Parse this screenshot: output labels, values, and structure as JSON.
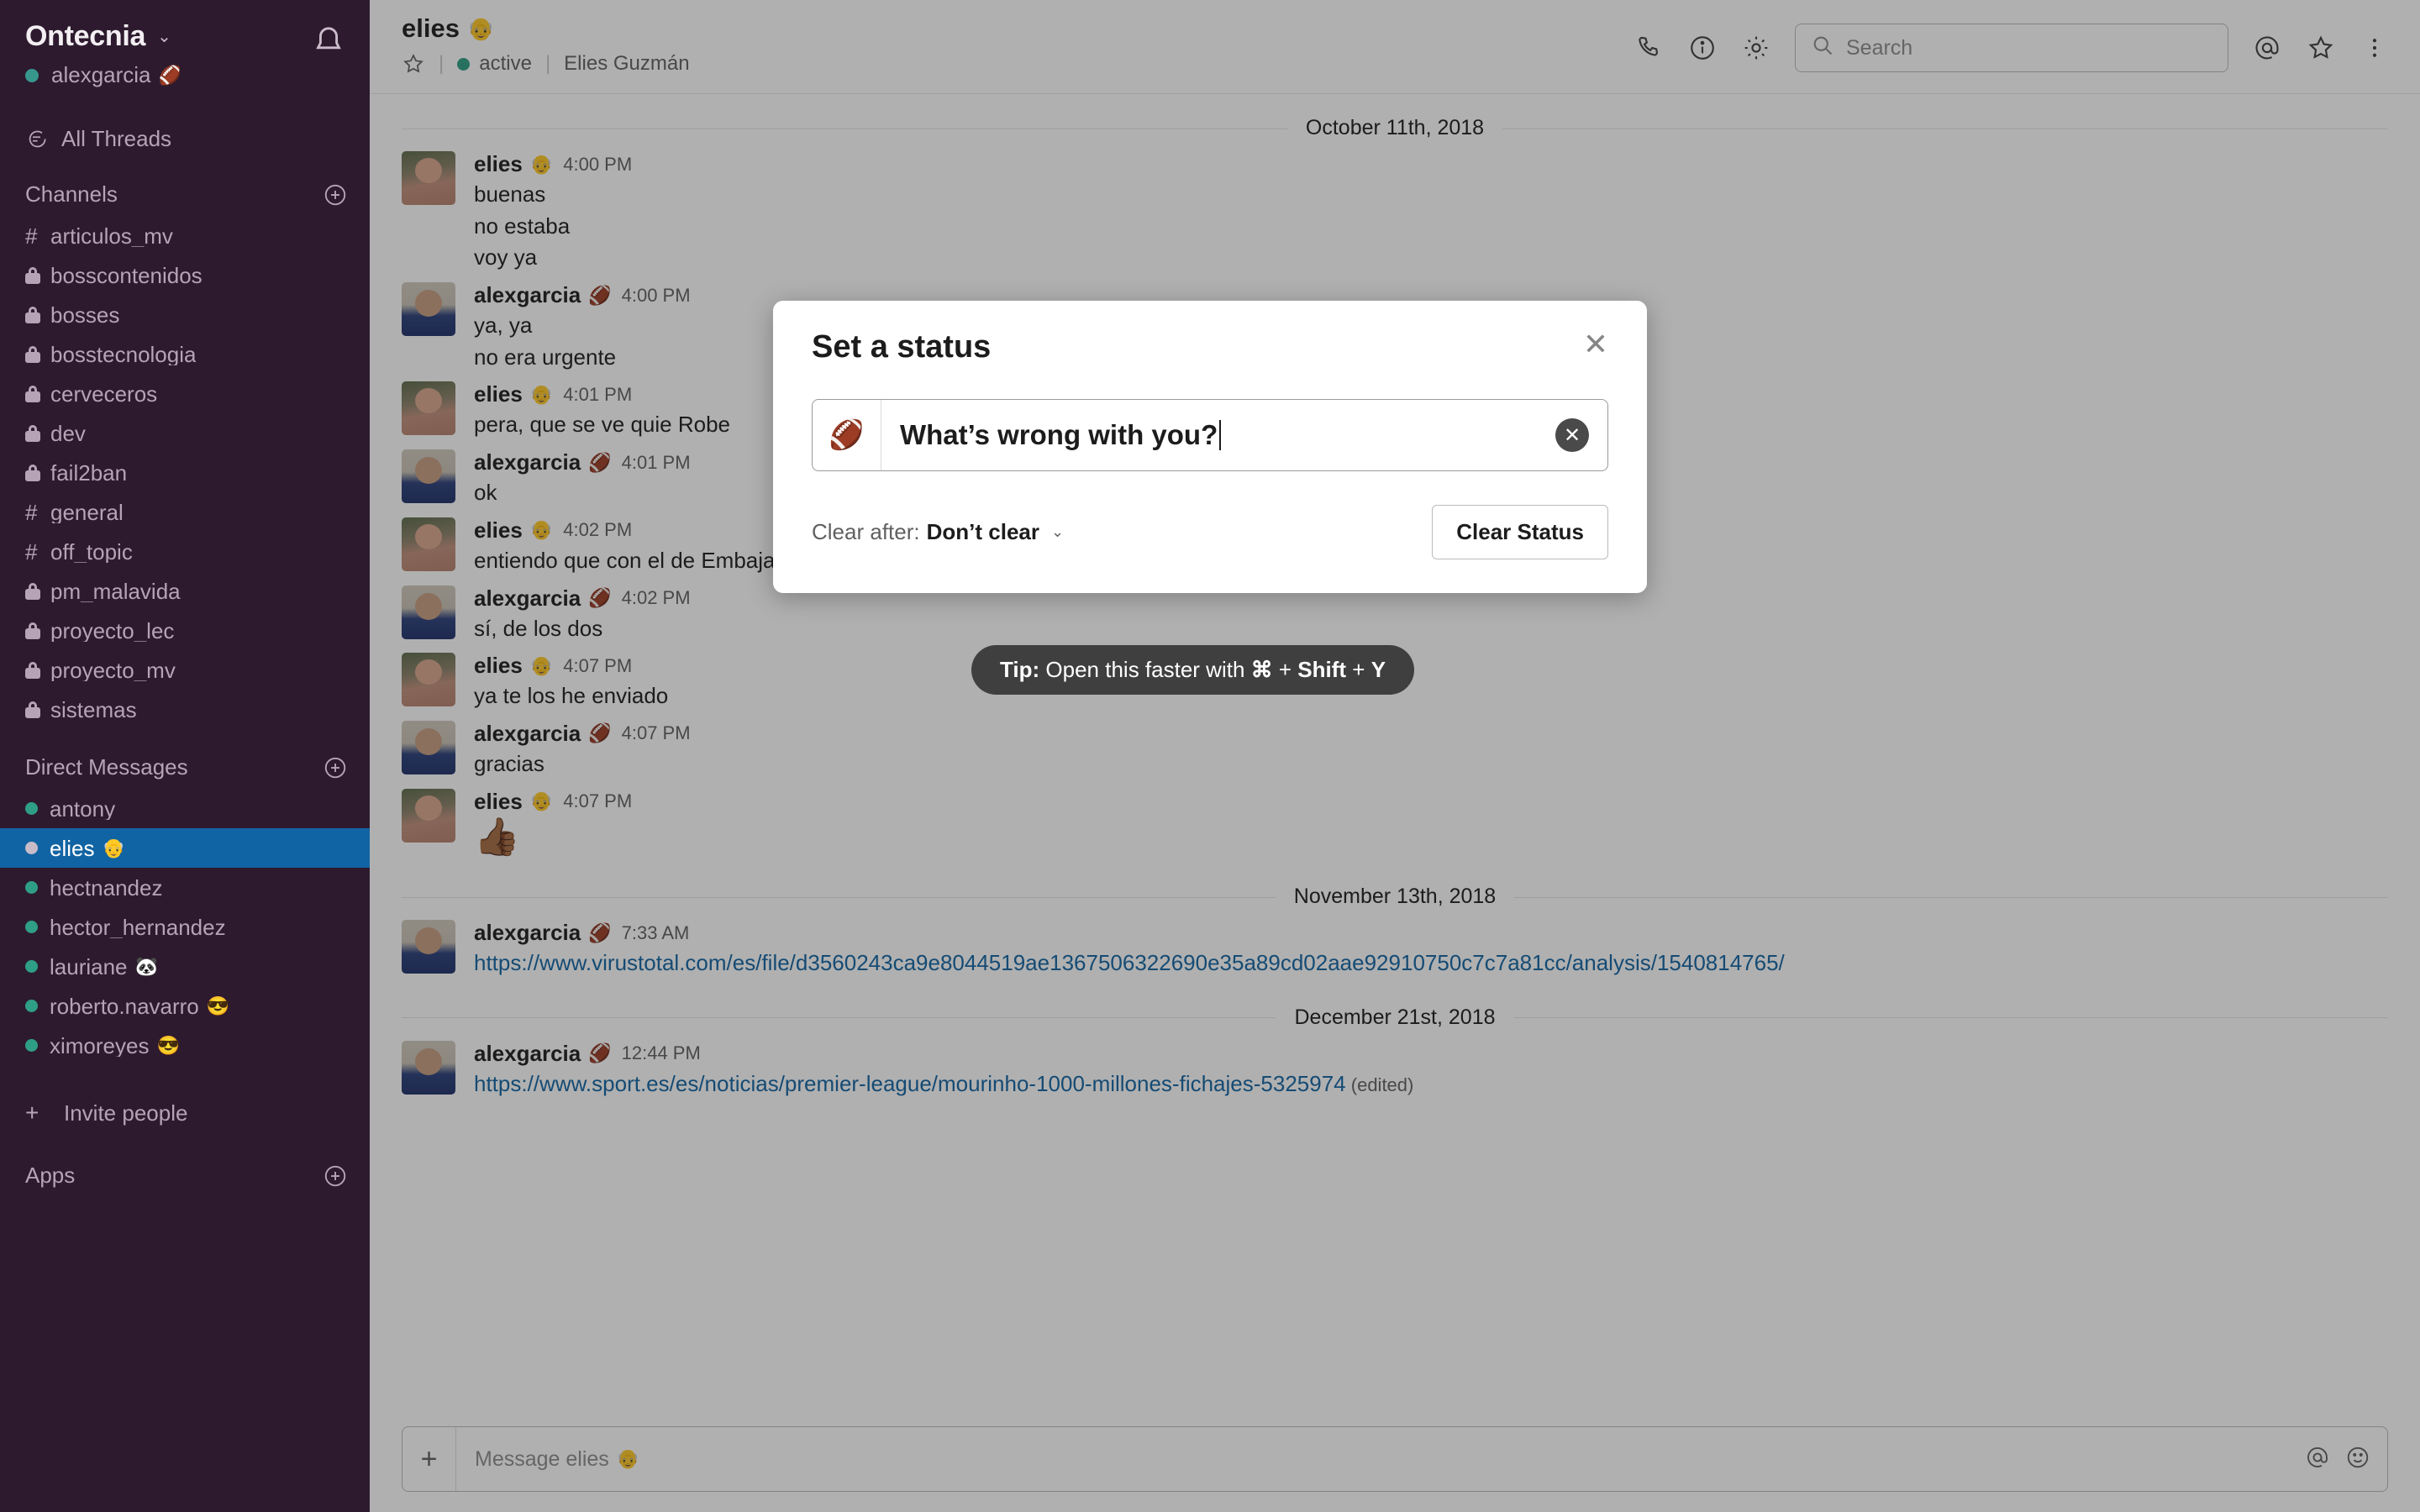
{
  "sidebar": {
    "workspace": "Ontecnia",
    "workspace_caret": "⌄",
    "user": "alexgarcia",
    "user_emoji": "🏈",
    "all_threads": "All Threads",
    "channels_header": "Channels",
    "channels": [
      {
        "name": "articulos_mv",
        "type": "public"
      },
      {
        "name": "bosscontenidos",
        "type": "private"
      },
      {
        "name": "bosses",
        "type": "private"
      },
      {
        "name": "bosstecnologia",
        "type": "private"
      },
      {
        "name": "cerveceros",
        "type": "private"
      },
      {
        "name": "dev",
        "type": "private"
      },
      {
        "name": "fail2ban",
        "type": "private"
      },
      {
        "name": "general",
        "type": "public"
      },
      {
        "name": "off_topic",
        "type": "public"
      },
      {
        "name": "pm_malavida",
        "type": "private"
      },
      {
        "name": "proyecto_lec",
        "type": "private"
      },
      {
        "name": "proyecto_mv",
        "type": "private"
      },
      {
        "name": "sistemas",
        "type": "private"
      }
    ],
    "dms_header": "Direct Messages",
    "dms": [
      {
        "name": "antony",
        "emoji": "",
        "selected": false,
        "presence": "active"
      },
      {
        "name": "elies",
        "emoji": "👴",
        "selected": true,
        "presence": "away"
      },
      {
        "name": "hectnandez",
        "emoji": "",
        "selected": false,
        "presence": "active"
      },
      {
        "name": "hector_hernandez",
        "emoji": "",
        "selected": false,
        "presence": "active"
      },
      {
        "name": "lauriane",
        "emoji": "🐼",
        "selected": false,
        "presence": "active"
      },
      {
        "name": "roberto.navarro",
        "emoji": "😎",
        "selected": false,
        "presence": "active"
      },
      {
        "name": "ximoreyes",
        "emoji": "😎",
        "selected": false,
        "presence": "active"
      }
    ],
    "invite_people": "Invite people",
    "apps_header": "Apps"
  },
  "topbar": {
    "channel_name": "elies",
    "channel_emoji": "👴",
    "status_text": "active",
    "full_name": "Elies Guzmán",
    "search_placeholder": "Search"
  },
  "conversation": {
    "groups": [
      {
        "date": "October 11th, 2018",
        "messages": [
          {
            "user": "elies",
            "emoji": "👴",
            "time": "4:00 PM",
            "avatar": "av-elies",
            "lines": [
              {
                "text": "buenas",
                "kind": "text"
              },
              {
                "text": "no estaba",
                "kind": "text"
              },
              {
                "text": "voy ya",
                "kind": "text"
              }
            ]
          },
          {
            "user": "alexgarcia",
            "emoji": "🏈",
            "time": "4:00 PM",
            "avatar": "av-alex",
            "lines": [
              {
                "text": "ya, ya",
                "kind": "text"
              },
              {
                "text": "no era urgente",
                "kind": "text"
              }
            ]
          },
          {
            "user": "elies",
            "emoji": "👴",
            "time": "4:01 PM",
            "avatar": "av-elies",
            "lines": [
              {
                "text": "pera, que se ve quie Robe",
                "kind": "text"
              }
            ]
          },
          {
            "user": "alexgarcia",
            "emoji": "🏈",
            "time": "4:01 PM",
            "avatar": "av-alex",
            "lines": [
              {
                "text": "ok",
                "kind": "text"
              }
            ]
          },
          {
            "user": "elies",
            "emoji": "👴",
            "time": "4:02 PM",
            "avatar": "av-elies",
            "lines": [
              {
                "text": "entiendo que con el de Embajadoras tenemos el visot bueno, no?",
                "kind": "text"
              }
            ]
          },
          {
            "user": "alexgarcia",
            "emoji": "🏈",
            "time": "4:02 PM",
            "avatar": "av-alex",
            "lines": [
              {
                "text": "sí, de los dos",
                "kind": "text"
              }
            ]
          },
          {
            "user": "elies",
            "emoji": "👴",
            "time": "4:07 PM",
            "avatar": "av-elies",
            "lines": [
              {
                "text": "ya te los he enviado",
                "kind": "text"
              }
            ]
          },
          {
            "user": "alexgarcia",
            "emoji": "🏈",
            "time": "4:07 PM",
            "avatar": "av-alex",
            "lines": [
              {
                "text": "gracias",
                "kind": "text"
              }
            ]
          },
          {
            "user": "elies",
            "emoji": "👴",
            "time": "4:07 PM",
            "avatar": "av-elies",
            "lines": [
              {
                "text": "👍🏾",
                "kind": "emoji"
              }
            ]
          }
        ]
      },
      {
        "date": "November 13th, 2018",
        "messages": [
          {
            "user": "alexgarcia",
            "emoji": "🏈",
            "time": "7:33 AM",
            "avatar": "av-alex",
            "lines": [
              {
                "text": "https://www.virustotal.com/es/file/d3560243ca9e8044519ae1367506322690e35a89cd02aae92910750c7c7a81cc/analysis/1540814765/",
                "kind": "link"
              }
            ]
          }
        ]
      },
      {
        "date": "December 21st, 2018",
        "messages": [
          {
            "user": "alexgarcia",
            "emoji": "🏈",
            "time": "12:44 PM",
            "avatar": "av-alex",
            "lines": [
              {
                "text": "https://www.sport.es/es/noticias/premier-league/mourinho-1000-millones-fichajes-5325974",
                "kind": "link",
                "edited": "(edited)"
              }
            ]
          }
        ]
      }
    ]
  },
  "composer": {
    "placeholder": "Message elies",
    "placeholder_emoji": "👴"
  },
  "modal": {
    "title": "Set a status",
    "status_emoji": "🏈",
    "status_value": "What’s wrong with you?",
    "clear_after_label": "Clear after:",
    "clear_after_value": "Don’t clear",
    "clear_after_caret": "⌄",
    "clear_status_button": "Clear Status"
  },
  "tooltip": {
    "prefix": "Tip:",
    "middle": " Open this faster with ",
    "key1": "⌘",
    "plus1": " + ",
    "key2": "Shift",
    "plus2": " + ",
    "key3": "Y"
  },
  "colors": {
    "sidebar_bg": "#2d1a2e",
    "selected_blue": "#1164a3",
    "link_blue": "#1264a3",
    "presence_green": "#2f9e86"
  }
}
